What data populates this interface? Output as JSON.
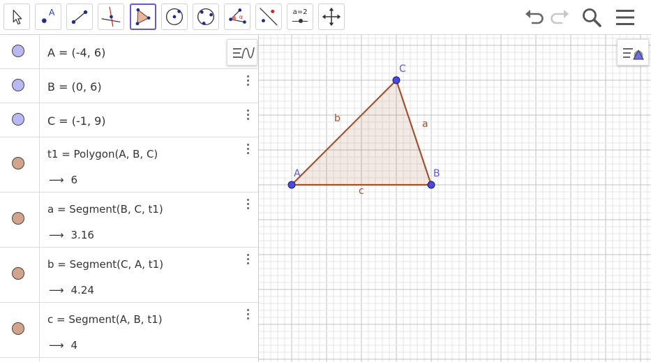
{
  "toolbar": {
    "tools": [
      {
        "name": "move-tool",
        "icon": "cursor-arrow-icon"
      },
      {
        "name": "point-tool",
        "icon": "point-a-icon",
        "label": "A"
      },
      {
        "name": "segment-tool",
        "icon": "segment-icon"
      },
      {
        "name": "perpendicular-line-tool",
        "icon": "perpendicular-line-icon"
      },
      {
        "name": "polygon-tool",
        "icon": "polygon-icon",
        "active": true
      },
      {
        "name": "circle-center-point-tool",
        "icon": "circle-center-icon"
      },
      {
        "name": "circle-three-points-tool",
        "icon": "circle-three-points-icon"
      },
      {
        "name": "angle-tool",
        "icon": "angle-icon",
        "label": "α"
      },
      {
        "name": "reflect-tool",
        "icon": "reflect-about-line-icon"
      },
      {
        "name": "slider-tool",
        "icon": "slider-icon",
        "label": "a=2"
      },
      {
        "name": "move-graphics-view-tool",
        "icon": "move-arrows-icon"
      }
    ],
    "undo_icon": "undo-icon",
    "redo_icon": "redo-icon",
    "search_icon": "search-icon",
    "menu_icon": "hamburger-menu-icon"
  },
  "algebra": {
    "style_bar_icon": "algebra-style-bar-icon",
    "rows": [
      {
        "def": "A = (-4, 6)",
        "color": "#b8b8f5",
        "kebab": false
      },
      {
        "def": "B = (0, 6)",
        "color": "#b8b8f5",
        "kebab": true
      },
      {
        "def": "C = (-1, 9)",
        "color": "#b8b8f5",
        "kebab": true
      },
      {
        "def": "t1 = Polygon(A, B, C)",
        "result": "6",
        "color": "#d3a48c",
        "kebab": true
      },
      {
        "def": "a = Segment(B, C, t1)",
        "result": "3.16",
        "color": "#d3a48c",
        "kebab": true
      },
      {
        "def": "b = Segment(C, A, t1)",
        "result": "4.24",
        "color": "#d3a48c",
        "kebab": true
      },
      {
        "def": "c = Segment(A, B, t1)",
        "result": "4",
        "color": "#d3a48c",
        "kebab": true
      }
    ]
  },
  "graphics": {
    "style_bar_icon": "graphics-style-bar-icon",
    "points": [
      {
        "name": "A",
        "x": -4,
        "y": 6
      },
      {
        "name": "B",
        "x": 0,
        "y": 6
      },
      {
        "name": "C",
        "x": -1,
        "y": 9
      }
    ],
    "segments": [
      {
        "name": "a",
        "from": "B",
        "to": "C"
      },
      {
        "name": "b",
        "from": "C",
        "to": "A"
      },
      {
        "name": "c",
        "from": "A",
        "to": "B"
      }
    ],
    "polygon_fill": "#a0522d",
    "point_color": "#4a4adb",
    "grid_major_color": "#c0c0c0",
    "grid_minor_color": "#e6e6e6"
  },
  "arrow_glyph": "⟶"
}
